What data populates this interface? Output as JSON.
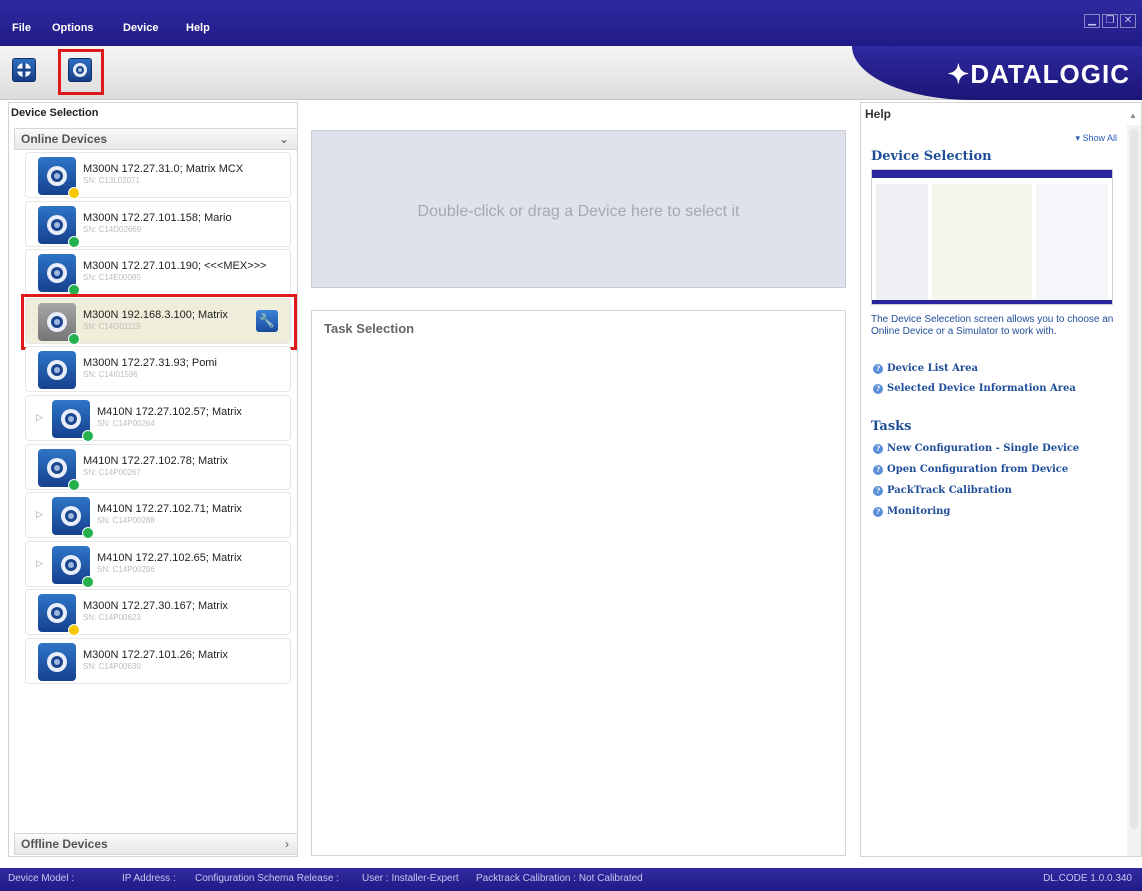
{
  "menu": [
    "File",
    "Options",
    "Device",
    "Help"
  ],
  "window_controls": [
    "minimize-icon",
    "restore-icon",
    "close-icon"
  ],
  "logo": "✦DATALOGIC",
  "left_panel": {
    "title": "Device Selection",
    "online_header": "Online Devices",
    "offline_header": "Offline Devices",
    "devices": [
      {
        "name": "M300N 172.27.31.0; Matrix MCX",
        "sn": "SN: C13L02071",
        "status": "yellow",
        "multi": false,
        "selected": false
      },
      {
        "name": "M300N 172.27.101.158; Mario",
        "sn": "SN: C14D02669",
        "status": "green",
        "multi": false,
        "selected": false
      },
      {
        "name": "M300N 172.27.101.190; <<<MEX>>>",
        "sn": "SN: C14E00085",
        "status": "green",
        "multi": false,
        "selected": false
      },
      {
        "name": "M300N 192.168.3.100; Matrix",
        "sn": "SN: C14G01119",
        "status": "green",
        "multi": false,
        "selected": true
      },
      {
        "name": "M300N 172.27.31.93; Pomi",
        "sn": "SN: C14I01596",
        "status": "none",
        "multi": false,
        "selected": false
      },
      {
        "name": "M410N 172.27.102.57; Matrix",
        "sn": "SN: C14P00264",
        "status": "green",
        "multi": true,
        "selected": false
      },
      {
        "name": "M410N 172.27.102.78; Matrix",
        "sn": "SN: C14P00267",
        "status": "green",
        "multi": false,
        "selected": false
      },
      {
        "name": "M410N 172.27.102.71; Matrix",
        "sn": "SN: C14P00288",
        "status": "green",
        "multi": true,
        "selected": false
      },
      {
        "name": "M410N 172.27.102.65; Matrix",
        "sn": "SN: C14P00296",
        "status": "green",
        "multi": true,
        "selected": false
      },
      {
        "name": "M300N 172.27.30.167; Matrix",
        "sn": "SN: C14P00623",
        "status": "yellow",
        "multi": false,
        "selected": false
      },
      {
        "name": "M300N 172.27.101.26; Matrix",
        "sn": "SN: C14P00630",
        "status": "none",
        "multi": false,
        "selected": false
      }
    ]
  },
  "drop_area": {
    "text": "Double-click or drag a Device here to select it"
  },
  "task_panel": {
    "title": "Task Selection"
  },
  "help_panel": {
    "title": "Help",
    "show_all": "▾ Show All",
    "heading": "Device Selection",
    "description": "The Device Selecetion screen allows you to choose an Online Device or a Simulator to work with.",
    "links": [
      "Device List Area",
      "Selected Device Information Area"
    ],
    "tasks_heading": "Tasks",
    "task_links": [
      "New Configuration - Single Device",
      "Open Configuration from Device",
      "PackTrack Calibration",
      "Monitoring"
    ]
  },
  "status_bar": {
    "device_model": "Device Model :",
    "ip_address": "IP Address :",
    "schema": "Configuration Schema Release :",
    "user": "User : Installer-Expert",
    "packtrack": "Packtrack Calibration : Not Calibrated",
    "version": "DL.CODE 1.0.0.340"
  },
  "colors": {
    "brand": "#2a24a0",
    "status_green": "#22b14c",
    "status_yellow": "#f5c800",
    "highlight": "#e01a1a"
  }
}
